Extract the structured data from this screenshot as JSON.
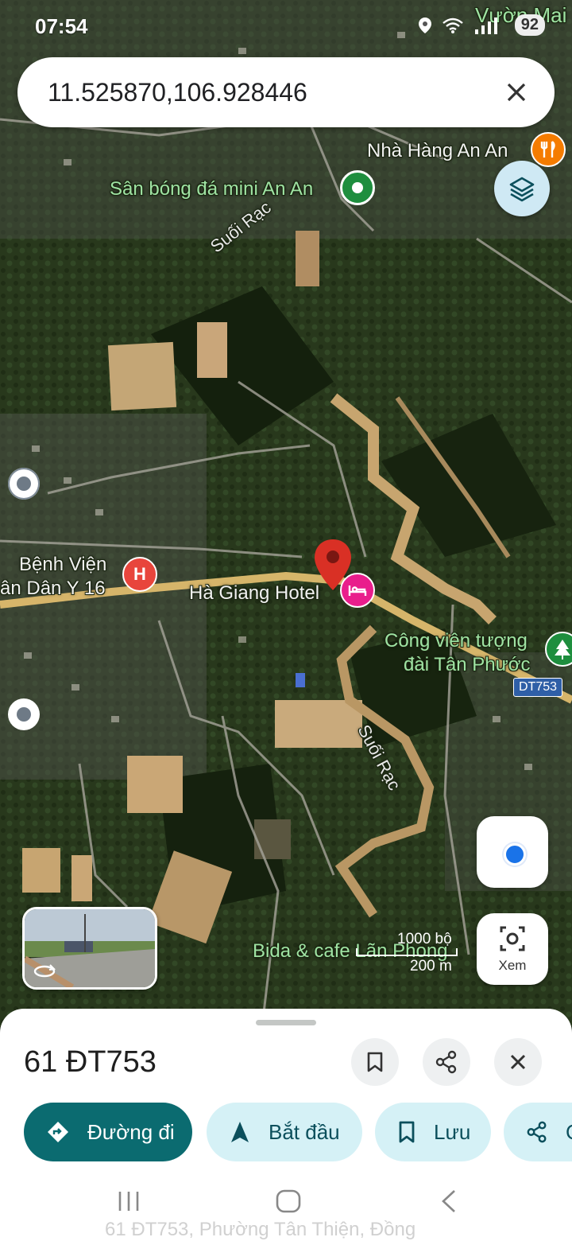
{
  "status": {
    "time": "07:54",
    "battery": "92"
  },
  "search": {
    "value": "11.525870,106.928446"
  },
  "map_labels": {
    "corner_label": "Vườn Mai",
    "restaurant": "Nhà Hàng An An",
    "stadium": "Sân bóng đá mini An An",
    "stream_top": "Suối Rạc",
    "hospital_line1": "Bệnh Viện",
    "hospital_line2": "ân Dân Y 16",
    "hotel": "Hà Giang Hotel",
    "park_line1": "Công viên tượng",
    "park_line2": "đài Tân Phước",
    "road_badge": "DT753",
    "stream_bottom": "Suối Rạc",
    "cafe": "Bida & cafe Lãn Phong"
  },
  "scale": {
    "feet": "1000 bộ",
    "meters": "200 m"
  },
  "controls": {
    "lens_label": "Xem"
  },
  "sheet": {
    "title": "61 ĐT753",
    "chips": [
      {
        "label": "Đường đi",
        "icon": "directions-icon"
      },
      {
        "label": "Bắt đầu",
        "icon": "navigation-arrow-icon"
      },
      {
        "label": "Lưu",
        "icon": "bookmark-icon"
      },
      {
        "label": "C",
        "icon": "share-icon"
      }
    ],
    "address_preview": "61 ĐT753, Phường Tân Thiện, Đồng"
  },
  "colors": {
    "pin": "#d93025",
    "primary_chip": "#0b6b70",
    "chip": "#d5f1f6",
    "poi_green": "#1e8e3e",
    "hospital": "#e8453c",
    "hotel": "#e91e8c",
    "restaurant": "#f57c00"
  }
}
